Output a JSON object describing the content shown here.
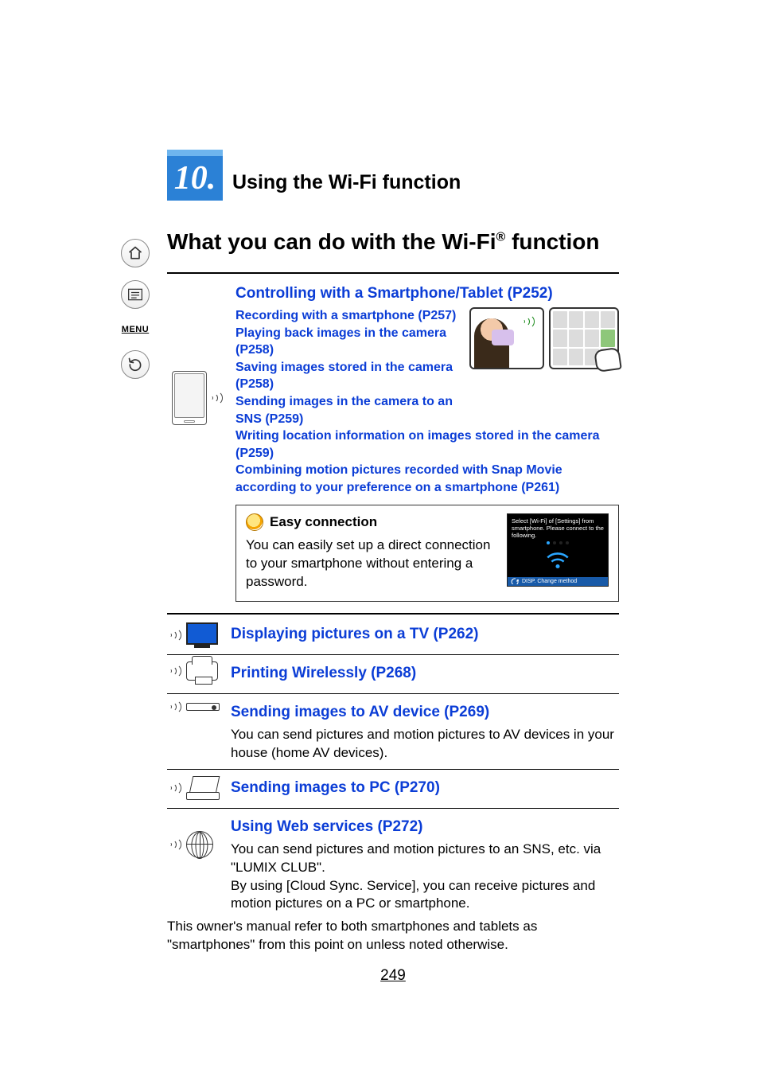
{
  "nav": {
    "menu_label": "MENU"
  },
  "chapter": {
    "number": "10.",
    "title": "Using the Wi-Fi function"
  },
  "heading_pre": "What you can do with the Wi-Fi",
  "heading_reg": "®",
  "heading_post": " function",
  "sec_smartphone": {
    "title": "Controlling with a Smartphone/Tablet (P252)",
    "links": [
      "Recording with a smartphone (P257)",
      "Playing back images in the camera (P258)",
      "Saving images stored in the camera (P258)",
      "Sending images in the camera to an SNS (P259)",
      "Writing location information on images stored in the camera (P259)",
      "Combining motion pictures recorded with Snap Movie according to your preference on a smartphone (P261)"
    ]
  },
  "easy": {
    "title": "Easy connection",
    "body": "You can easily set up a direct connection to your smartphone without entering a password.",
    "screen_msg": "Select [Wi-Fi] of [Settings] from smartphone. Please connect to the following.",
    "screen_bar": "DISP. Change method"
  },
  "sec_tv": {
    "title": "Displaying pictures on a TV (P262)"
  },
  "sec_print": {
    "title": "Printing Wirelessly (P268)"
  },
  "sec_av": {
    "title": "Sending images to AV device (P269)",
    "body": "You can send pictures and motion pictures to AV devices in your house (home AV devices)."
  },
  "sec_pc": {
    "title": "Sending images to PC (P270)"
  },
  "sec_web": {
    "title": "Using Web services (P272)",
    "body1": "You can send pictures and motion pictures to an SNS, etc. via \"LUMIX CLUB\".",
    "body2": "By using [Cloud Sync. Service], you can receive pictures and motion pictures on a PC or smartphone."
  },
  "note": "This owner's manual refer to both smartphones and tablets as \"smartphones\" from this point on unless noted otherwise.",
  "page_number": "249"
}
